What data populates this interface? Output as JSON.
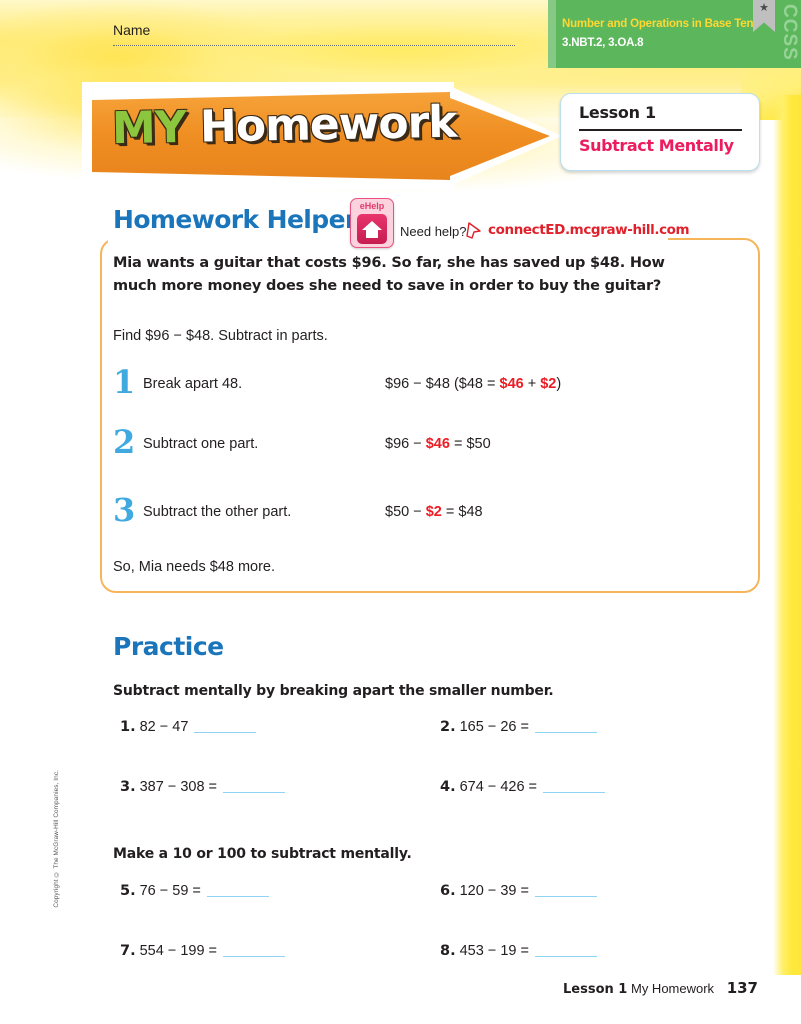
{
  "page": {
    "name_label": "Name",
    "copyright": "Copyright © The McGraw-Hill Companies, Inc.",
    "accent_blue": "#1b75bb",
    "accent_red": "#ed1c24",
    "accent_orange": "#ef8e22",
    "accent_pink": "#ec1c5e",
    "accent_green": "#5cb75c",
    "blank_line_color": "#8ed3f4"
  },
  "ccss": {
    "domain_title": "Number and Operations in Base Ten",
    "standards": "3.NBT.2, 3.OA.8",
    "vertical_label": "CCSS"
  },
  "banner": {
    "word1": "MY",
    "word2": "Homework"
  },
  "lesson_box": {
    "lesson": "Lesson 1",
    "title": "Subtract Mentally"
  },
  "helper": {
    "heading": "Homework Helper",
    "ehelp_label": "eHelp",
    "need_help": "Need help?",
    "link": "connectED.mcgraw-hill.com",
    "problem": "Mia wants a guitar that costs $96. So far, she has saved up $48. How much more money does she need to save in order to buy the guitar?",
    "find_line": "Find $96 − $48. Subtract in parts.",
    "steps": [
      {
        "number": "1",
        "label": "Break apart 48.",
        "eq_pre": "$96 − $48  ($48 = ",
        "eq_red1": "$46",
        "eq_mid": " + ",
        "eq_red2": "$2",
        "eq_post": ")"
      },
      {
        "number": "2",
        "label": "Subtract one part.",
        "eq_pre": "$96 − ",
        "eq_red1": "$46",
        "eq_mid": "",
        "eq_red2": "",
        "eq_post": " = $50"
      },
      {
        "number": "3",
        "label": "Subtract the other part.",
        "eq_pre": "$50 − ",
        "eq_red1": "$2",
        "eq_mid": "",
        "eq_red2": "",
        "eq_post": " = $48"
      }
    ],
    "conclusion": "So, Mia needs $48 more."
  },
  "practice": {
    "heading": "Practice",
    "directions_1": "Subtract mentally by breaking apart the smaller number.",
    "directions_2": "Make a 10 or 100 to subtract mentally.",
    "problems": [
      {
        "num": "1.",
        "expr": "82 − 47"
      },
      {
        "num": "2.",
        "expr": "165 − 26 ="
      },
      {
        "num": "3.",
        "expr": "387 − 308 ="
      },
      {
        "num": "4.",
        "expr": "674 − 426 ="
      },
      {
        "num": "5.",
        "expr": "76 − 59 ="
      },
      {
        "num": "6.",
        "expr": "120 − 39 ="
      },
      {
        "num": "7.",
        "expr": "554 − 199 ="
      },
      {
        "num": "8.",
        "expr": "453 − 19 ="
      }
    ]
  },
  "footer": {
    "lesson": "Lesson 1",
    "section": "My Homework",
    "page_number": "137"
  }
}
